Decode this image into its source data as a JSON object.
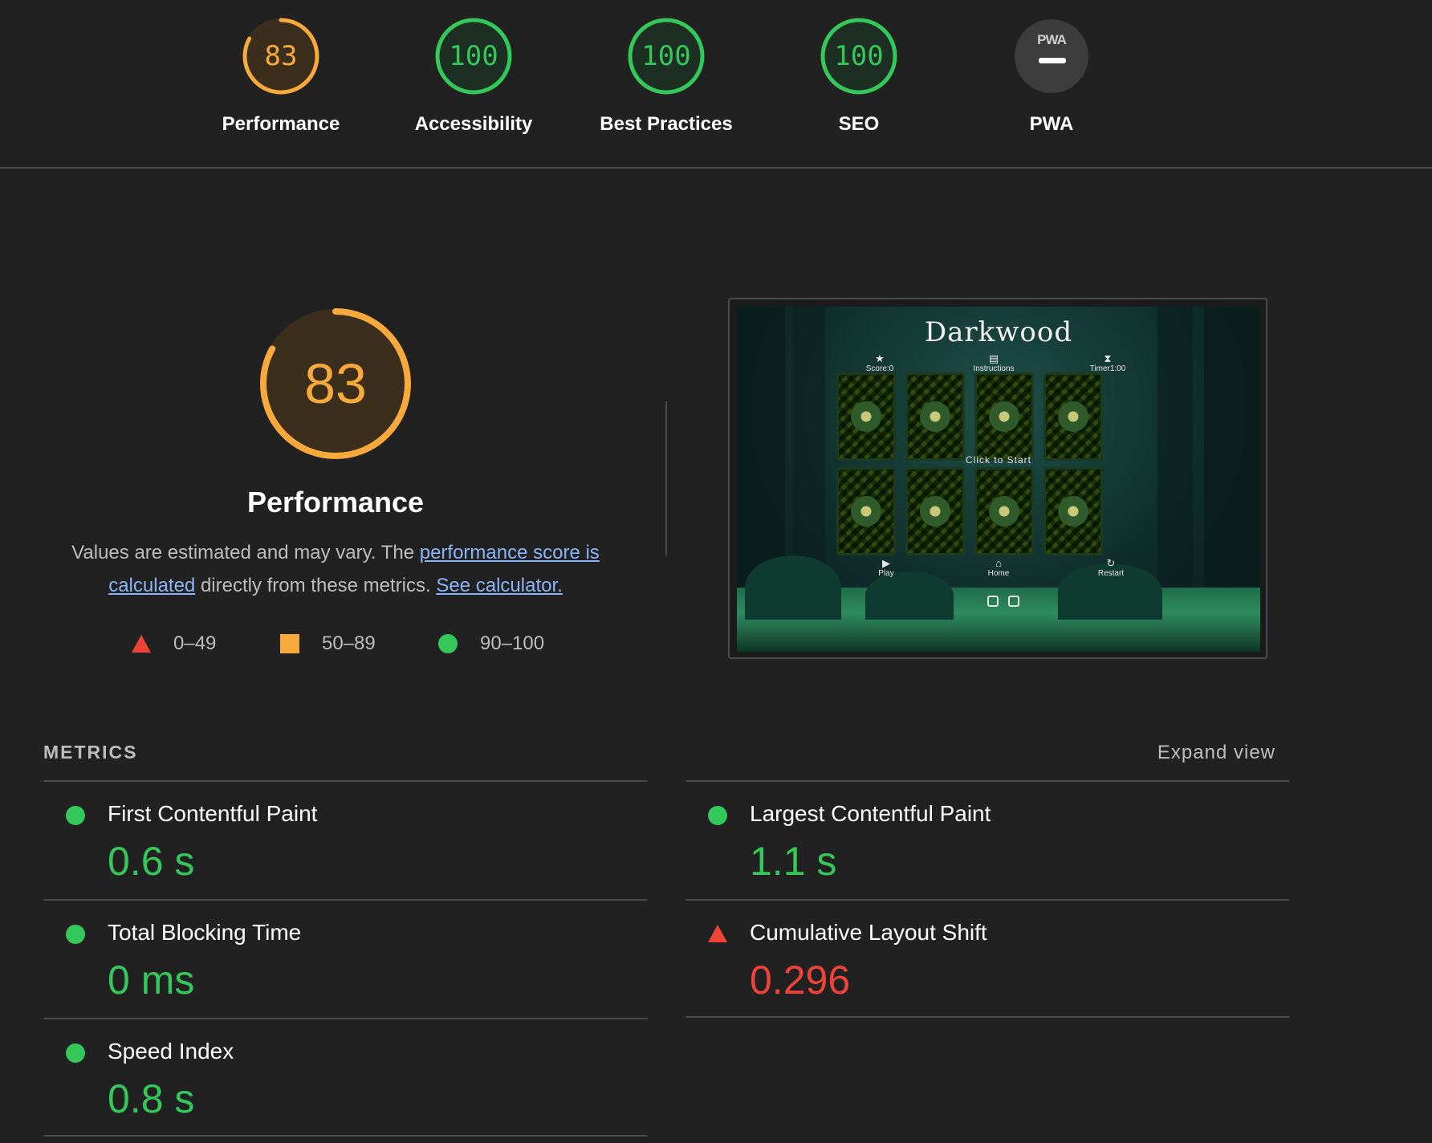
{
  "colors": {
    "good": "#34c759",
    "average": "#f7a93b",
    "poor": "#ef4338",
    "link": "#8ab4f8",
    "background": "#212121"
  },
  "categories": [
    {
      "label": "Performance",
      "score": "83",
      "score_value": 83,
      "rating": "average"
    },
    {
      "label": "Accessibility",
      "score": "100",
      "score_value": 100,
      "rating": "good"
    },
    {
      "label": "Best Practices",
      "score": "100",
      "score_value": 100,
      "rating": "good"
    },
    {
      "label": "SEO",
      "score": "100",
      "score_value": 100,
      "rating": "good"
    },
    {
      "label": "PWA",
      "badge_text": "PWA",
      "rating": "na"
    }
  ],
  "performance": {
    "score": "83",
    "score_value": 83,
    "title": "Performance",
    "description_prefix": "Values are estimated and may vary. The ",
    "score_link": "performance score is calculated",
    "description_middle": " directly from these metrics. ",
    "calculator_link": "See calculator.",
    "legend": [
      {
        "shape": "triangle",
        "range": "0–49"
      },
      {
        "shape": "square",
        "range": "50–89"
      },
      {
        "shape": "circle",
        "range": "90–100"
      }
    ]
  },
  "screenshot": {
    "title": "Darkwood",
    "hud": {
      "score": "Score:0",
      "instructions": "Instructions",
      "timer": "Timer1:00"
    },
    "center_text": "Click to Start",
    "controls": {
      "play": "Play",
      "home": "Home",
      "restart": "Restart"
    }
  },
  "metrics_section": {
    "heading": "METRICS",
    "expand_label": "Expand view",
    "items": [
      {
        "name": "First Contentful Paint",
        "value": "0.6 s",
        "rating": "good"
      },
      {
        "name": "Largest Contentful Paint",
        "value": "1.1 s",
        "rating": "good"
      },
      {
        "name": "Total Blocking Time",
        "value": "0 ms",
        "rating": "good"
      },
      {
        "name": "Cumulative Layout Shift",
        "value": "0.296",
        "rating": "poor"
      },
      {
        "name": "Speed Index",
        "value": "0.8 s",
        "rating": "good"
      }
    ]
  }
}
